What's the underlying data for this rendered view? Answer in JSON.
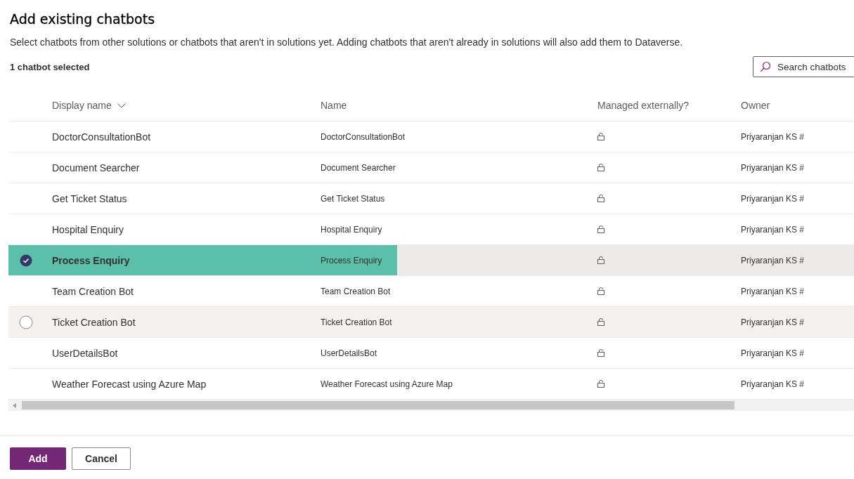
{
  "title": "Add existing chatbots",
  "description": "Select chatbots from other solutions or chatbots that aren't in solutions yet. Adding chatbots that aren't already in solutions will also add them to Dataverse.",
  "selection_count": "1 chatbot selected",
  "search": {
    "placeholder": "Search chatbots"
  },
  "table": {
    "columns": [
      {
        "label": "Display name",
        "sortable": true
      },
      {
        "label": "Name",
        "sortable": false
      },
      {
        "label": "Managed externally?",
        "sortable": false
      },
      {
        "label": "Owner",
        "sortable": false
      }
    ],
    "rows": [
      {
        "display_name": "DoctorConsultationBot",
        "name": "DoctorConsultationBot",
        "owner": "Priyaranjan KS #",
        "selected": false,
        "hovered": false
      },
      {
        "display_name": "Document Searcher",
        "name": "Document Searcher",
        "owner": "Priyaranjan KS #",
        "selected": false,
        "hovered": false
      },
      {
        "display_name": "Get Ticket Status",
        "name": "Get Ticket Status",
        "owner": "Priyaranjan KS #",
        "selected": false,
        "hovered": false
      },
      {
        "display_name": "Hospital Enquiry",
        "name": "Hospital Enquiry",
        "owner": "Priyaranjan KS #",
        "selected": false,
        "hovered": false
      },
      {
        "display_name": "Process Enquiry",
        "name": "Process Enquiry",
        "owner": "Priyaranjan KS #",
        "selected": true,
        "hovered": false
      },
      {
        "display_name": "Team Creation Bot",
        "name": "Team Creation Bot",
        "owner": "Priyaranjan KS #",
        "selected": false,
        "hovered": false
      },
      {
        "display_name": "Ticket Creation Bot",
        "name": "Ticket Creation Bot",
        "owner": "Priyaranjan KS #",
        "selected": false,
        "hovered": true
      },
      {
        "display_name": "UserDetailsBot",
        "name": "UserDetailsBot",
        "owner": "Priyaranjan KS #",
        "selected": false,
        "hovered": false
      },
      {
        "display_name": "Weather Forecast using Azure Map",
        "name": "Weather Forecast using Azure Map",
        "owner": "Priyaranjan KS #",
        "selected": false,
        "hovered": false
      }
    ]
  },
  "buttons": [
    {
      "label": "Add",
      "kind": "primary"
    },
    {
      "label": "Cancel",
      "kind": "secondary"
    }
  ]
}
